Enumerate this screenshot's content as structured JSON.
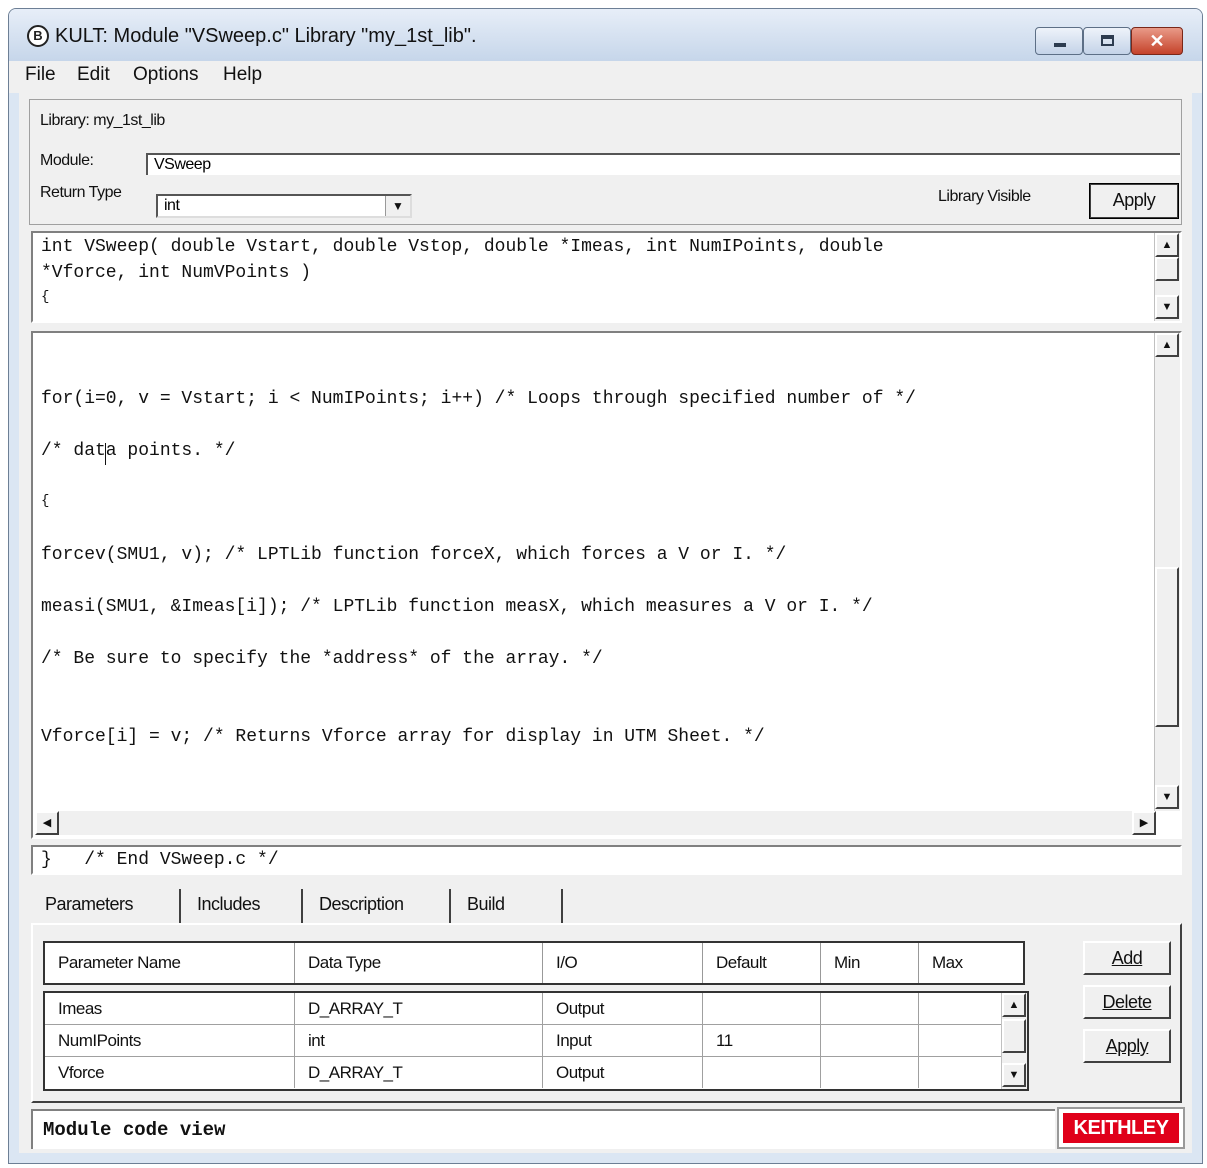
{
  "window": {
    "title": "KULT: Module \"VSweep.c\" Library \"my_1st_lib\".",
    "app_icon_letter": "B"
  },
  "menu": [
    "File",
    "Edit",
    "Options",
    "Help"
  ],
  "header": {
    "library_label": "Library: my_1st_lib",
    "module_label": "Module:",
    "module_value": "VSweep",
    "return_type_label": "Return Type",
    "return_type_value": "int",
    "library_visible_label": "Library Visible",
    "apply_label": "Apply"
  },
  "prototype_lines": [
    "int VSweep( double Vstart, double Vstop, double *Imeas, int NumIPoints, double",
    "*Vforce, int NumVPoints )",
    "{"
  ],
  "code_lines": [
    "for(i=0, v = Vstart; i < NumIPoints; i++) /* Loops through specified number of */",
    "/* data points. */",
    "{",
    "forcev(SMU1, v); /* LPTLib function forceX, which forces a V or I. */",
    "measi(SMU1, &Imeas[i]); /* LPTLib function measX, which measures a V or I. */",
    "/* Be sure to specify the *address* of the array. */",
    "Vforce[i] = v; /* Returns Vforce array for display in UTM Sheet. */"
  ],
  "end_line": "}   /* End VSweep.c */",
  "tabs": [
    "Parameters",
    "Includes",
    "Description",
    "Build"
  ],
  "params": {
    "columns": [
      "Parameter Name",
      "Data Type",
      "I/O",
      "Default",
      "Min",
      "Max"
    ],
    "rows": [
      [
        "Imeas",
        "D_ARRAY_T",
        "Output",
        "",
        "",
        ""
      ],
      [
        "NumIPoints",
        "int",
        "Input",
        "11",
        "",
        ""
      ],
      [
        "Vforce",
        "D_ARRAY_T",
        "Output",
        "",
        "",
        ""
      ]
    ],
    "add_label": "Add",
    "delete_label": "Delete",
    "apply_label": "Apply"
  },
  "status": {
    "text": "Module code view",
    "logo": "KEITHLEY"
  },
  "colors": {
    "logo_red": "#e0001a",
    "window_frame": "#dbe6f3"
  }
}
